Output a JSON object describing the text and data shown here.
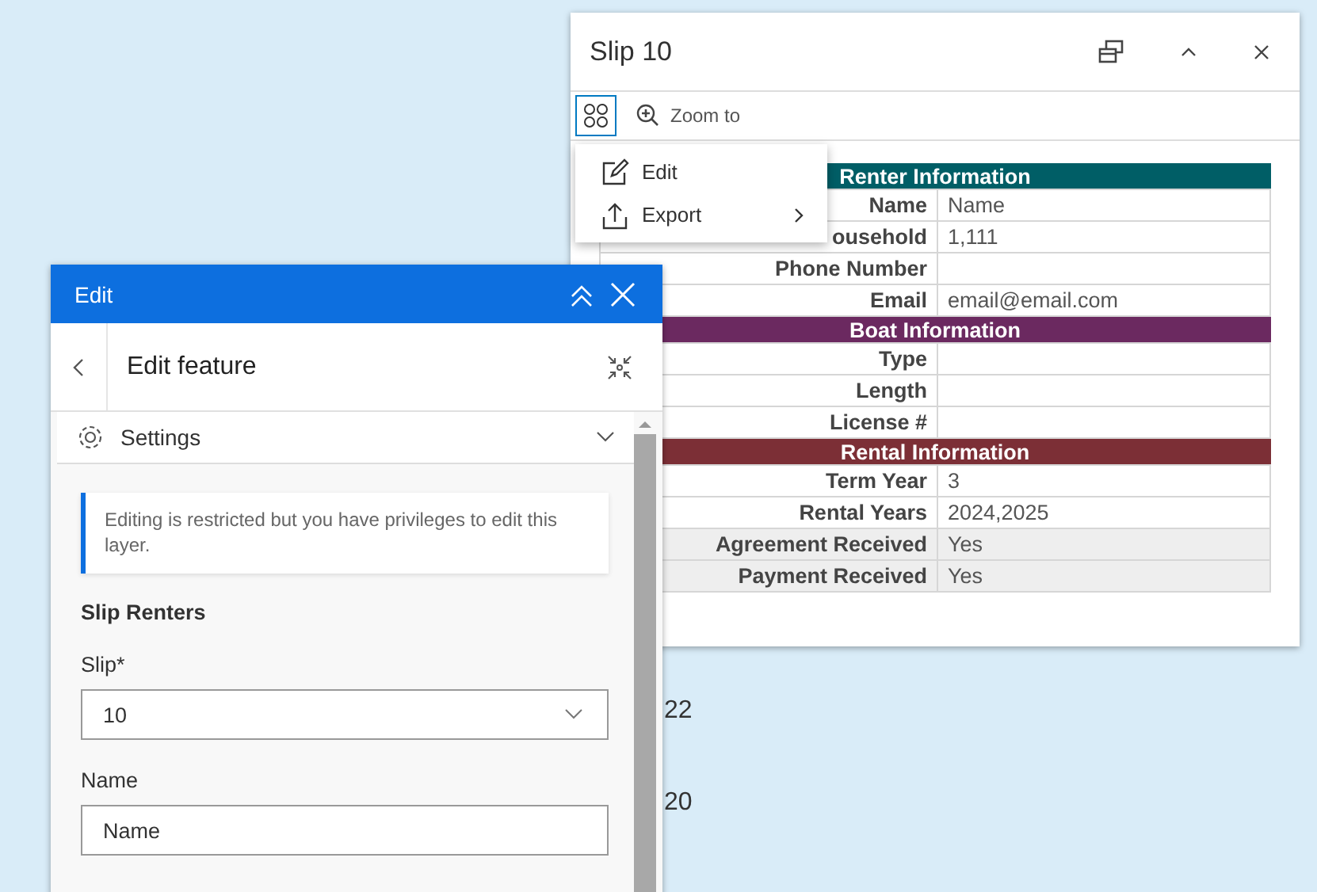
{
  "map_labels": [
    "22",
    "20"
  ],
  "popup": {
    "title": "Slip 10",
    "zoom_label": "Zoom to",
    "menu": [
      {
        "label": "Edit",
        "kind": "edit",
        "submenu": false
      },
      {
        "label": "Export",
        "kind": "export",
        "submenu": true
      }
    ],
    "sections": [
      {
        "title": "Renter Information",
        "color": "#005e66",
        "rows": [
          {
            "label": "Name",
            "value": "Name",
            "shaded": false
          },
          {
            "label": "ousehold",
            "value": "1,111",
            "shaded": false
          },
          {
            "label": "Phone Number",
            "value": "",
            "shaded": false
          },
          {
            "label": "Email",
            "value": "email@email.com",
            "shaded": false
          }
        ]
      },
      {
        "title": "Boat Information",
        "color": "#6b2960",
        "rows": [
          {
            "label": "Type",
            "value": "",
            "shaded": false
          },
          {
            "label": "Length",
            "value": "",
            "shaded": false
          },
          {
            "label": "License #",
            "value": "",
            "shaded": false
          }
        ]
      },
      {
        "title": "Rental Information",
        "color": "#7c2f36",
        "rows": [
          {
            "label": "Term Year",
            "value": "3",
            "shaded": false
          },
          {
            "label": "Rental Years",
            "value": "2024,2025",
            "shaded": false
          },
          {
            "label": "Agreement Received",
            "value": "Yes",
            "shaded": true
          },
          {
            "label": "Payment Received",
            "value": "Yes",
            "shaded": true
          }
        ]
      }
    ]
  },
  "edit_panel": {
    "title": "Edit",
    "subtitle": "Edit feature",
    "settings_label": "Settings",
    "settings_expanded": false,
    "notice": "Editing is restricted but you have privileges to edit this layer.",
    "group_title": "Slip Renters",
    "fields": [
      {
        "label": "Slip*",
        "kind": "select",
        "value": "10"
      },
      {
        "label": "Name",
        "kind": "text",
        "value": "Name"
      }
    ]
  }
}
